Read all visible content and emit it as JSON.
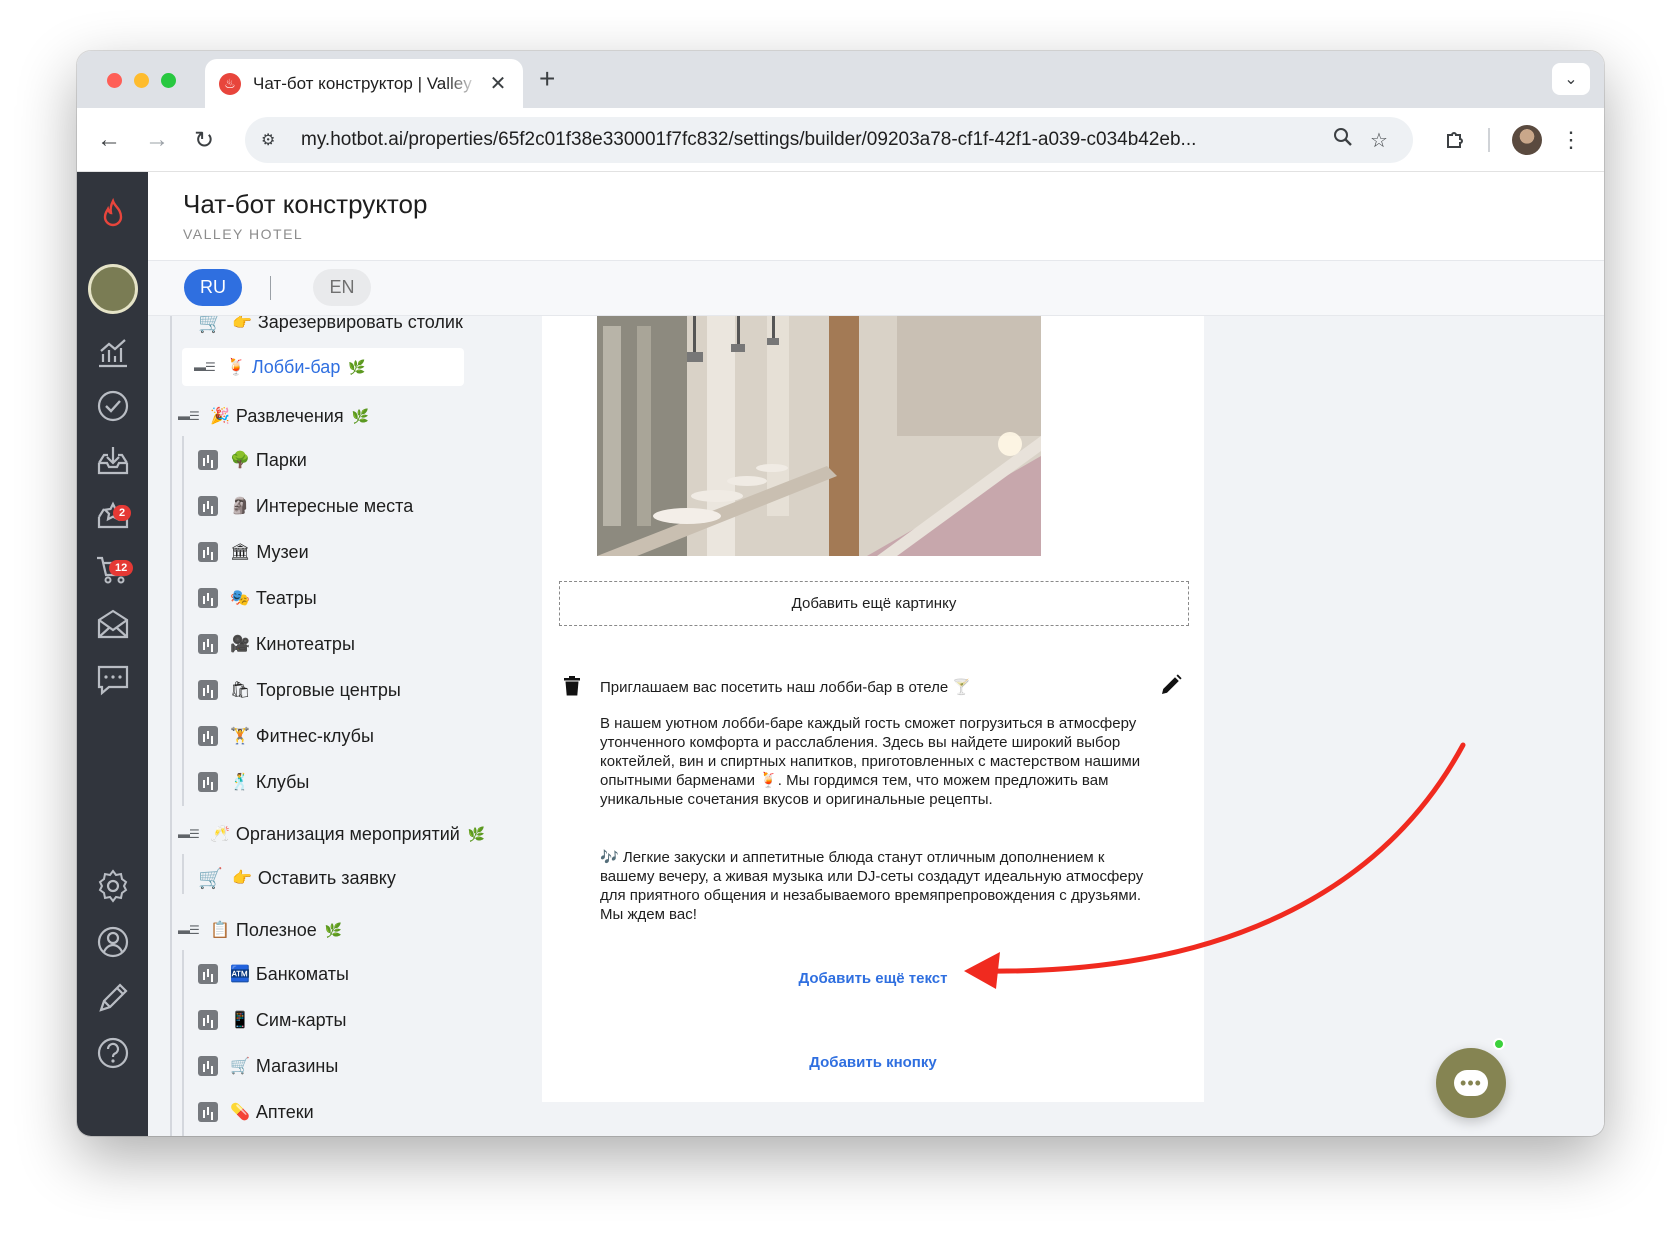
{
  "browser": {
    "tab_title": "Чат-бот конструктор | Valley",
    "url": "my.hotbot.ai/properties/65f2c01f38e330001f7fc832/settings/builder/09203a78-cf1f-42f1-a039-c034b42eb..."
  },
  "header": {
    "title": "Чат-бот конструктор",
    "subtitle": "VALLEY HOTEL"
  },
  "languages": {
    "ru": "RU",
    "en": "EN"
  },
  "sidebar_badges": {
    "reviews": "2",
    "orders": "12"
  },
  "tree": {
    "partial_item": "Зарезервировать столик",
    "selected_item": "Лобби-бар",
    "sections": [
      {
        "label": "Развлечения",
        "emoji": "🎉"
      },
      {
        "label": "Организация мероприятий",
        "emoji": "🥂"
      },
      {
        "label": "Полезное",
        "emoji": "📋"
      }
    ],
    "entertainment": [
      {
        "label": "Парки",
        "emoji": "🌳"
      },
      {
        "label": "Интересные места",
        "emoji": "🗿"
      },
      {
        "label": "Музеи",
        "emoji": "🏛"
      },
      {
        "label": "Театры",
        "emoji": "🎭"
      },
      {
        "label": "Кинотеатры",
        "emoji": "🎥"
      },
      {
        "label": "Торговые центры",
        "emoji": "🛍"
      },
      {
        "label": "Фитнес-клубы",
        "emoji": "🏋"
      },
      {
        "label": "Клубы",
        "emoji": "🕺"
      }
    ],
    "events": [
      {
        "label": "Оставить заявку",
        "emoji": "👉"
      }
    ],
    "useful": [
      {
        "label": "Банкоматы",
        "emoji": "🏧"
      },
      {
        "label": "Сим-карты",
        "emoji": "📱"
      },
      {
        "label": "Магазины",
        "emoji": "🛒"
      },
      {
        "label": "Аптеки",
        "emoji": "💊"
      }
    ]
  },
  "editor": {
    "add_image": "Добавить ещё картинку",
    "message_title": "Приглашаем вас посетить наш лобби-бар в отеле 🍸",
    "paragraph_1": "В нашем уютном лобби-баре каждый гость сможет погрузиться в атмосферу утонченного комфорта и расслабления. Здесь вы найдете широкий выбор коктейлей, вин и спиртных напитков, приготовленных с мастерством нашими опытными барменами 🍹. Мы гордимся тем, что можем предложить вам уникальные сочетания вкусов и оригинальные рецепты.",
    "paragraph_2": "🎶 Легкие закуски и аппетитные блюда станут отличным дополнением к вашему вечеру, а живая музыка или DJ-сеты создадут идеальную атмосферу для приятного общения и незабываемого времяпрепровождения с друзьями. Мы ждем вас!",
    "add_text": "Добавить ещё текст",
    "add_button": "Добавить кнопку"
  },
  "colors": {
    "accent": "#2f6fe0",
    "sidebar_bg": "#31353d",
    "arrow": "#f02a1f",
    "chat_button": "#858452"
  }
}
